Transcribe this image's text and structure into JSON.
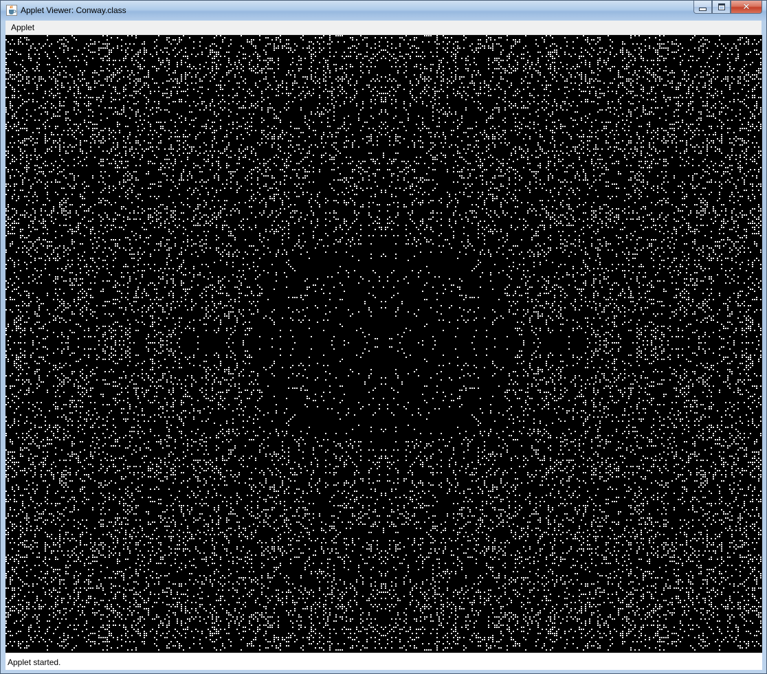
{
  "window": {
    "title": "Applet Viewer: Conway.class",
    "icon": "java-cup-icon",
    "controls": [
      "minimize-icon",
      "maximize-icon",
      "close-icon"
    ]
  },
  "menubar": {
    "items": [
      {
        "label": "Applet"
      }
    ]
  },
  "canvas": {
    "description_type": "game-of-life-grid",
    "background": "#000000",
    "cell_color": "#ffffff"
  },
  "status": {
    "text": "Applet started."
  },
  "colors": {
    "title_bar": "#aecbea",
    "close_button": "#c4412a",
    "menu_bg": "#f0f0f0"
  }
}
